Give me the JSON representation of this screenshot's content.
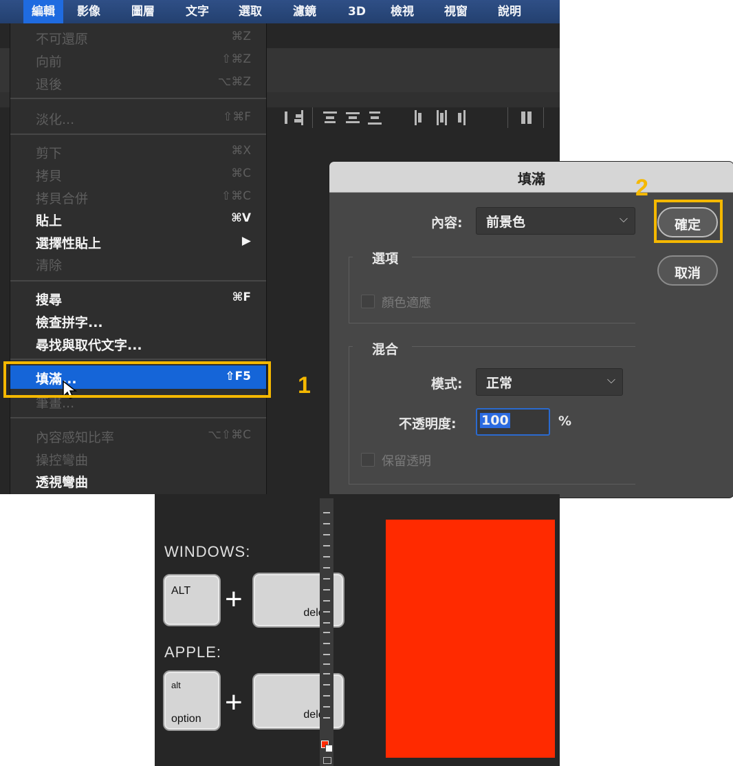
{
  "menubar": {
    "items": [
      "編輯",
      "影像",
      "圖層",
      "文字",
      "選取",
      "濾鏡",
      "3D",
      "檢視",
      "視窗",
      "說明"
    ],
    "active": "編輯"
  },
  "edit_menu": {
    "items": [
      {
        "label": "不可還原",
        "shortcut": "⌘Z"
      },
      {
        "label": "向前",
        "shortcut": "⇧⌘Z"
      },
      {
        "label": "退後",
        "shortcut": "⌥⌘Z"
      },
      {
        "label": "淡化...",
        "shortcut": "⇧⌘F"
      },
      {
        "label": "剪下",
        "shortcut": "⌘X"
      },
      {
        "label": "拷貝",
        "shortcut": "⌘C"
      },
      {
        "label": "拷貝合併",
        "shortcut": "⇧⌘C"
      },
      {
        "label": "貼上",
        "shortcut": "⌘V"
      },
      {
        "label": "選擇性貼上",
        "shortcut": "▶"
      },
      {
        "label": "清除",
        "shortcut": ""
      },
      {
        "label": "搜尋",
        "shortcut": "⌘F"
      },
      {
        "label": "檢查拼字...",
        "shortcut": ""
      },
      {
        "label": "尋找與取代文字...",
        "shortcut": ""
      },
      {
        "label": "填滿...",
        "shortcut": "⇧F5"
      },
      {
        "label": "筆畫...",
        "shortcut": ""
      },
      {
        "label": "內容感知比率",
        "shortcut": "⌥⇧⌘C"
      },
      {
        "label": "操控彎曲",
        "shortcut": ""
      },
      {
        "label": "透視彎曲",
        "shortcut": ""
      }
    ]
  },
  "steps": {
    "one": "1",
    "two": "2"
  },
  "fill_dialog": {
    "title": "填滿",
    "contents_label": "內容:",
    "contents_value": "前景色",
    "options_group": "選項",
    "color_adapt": "顏色適應",
    "blending_group": "混合",
    "mode_label": "模式:",
    "mode_value": "正常",
    "opacity_label": "不透明度:",
    "opacity_value": "100",
    "opacity_unit": "%",
    "preserve_transparency": "保留透明",
    "ok_button": "確定",
    "cancel_button": "取消"
  },
  "shortcut_illustration": {
    "windows_label": "WINDOWS:",
    "apple_label": "APPLE:",
    "alt_key": "ALT",
    "alt_small": "alt",
    "option_key": "option",
    "delete_key": "delete",
    "plus": "+"
  },
  "colors": {
    "menubar": "#2f4f86",
    "highlight": "#1565d8",
    "callout": "#f5b800",
    "foreground_fill": "#ff2a00"
  }
}
